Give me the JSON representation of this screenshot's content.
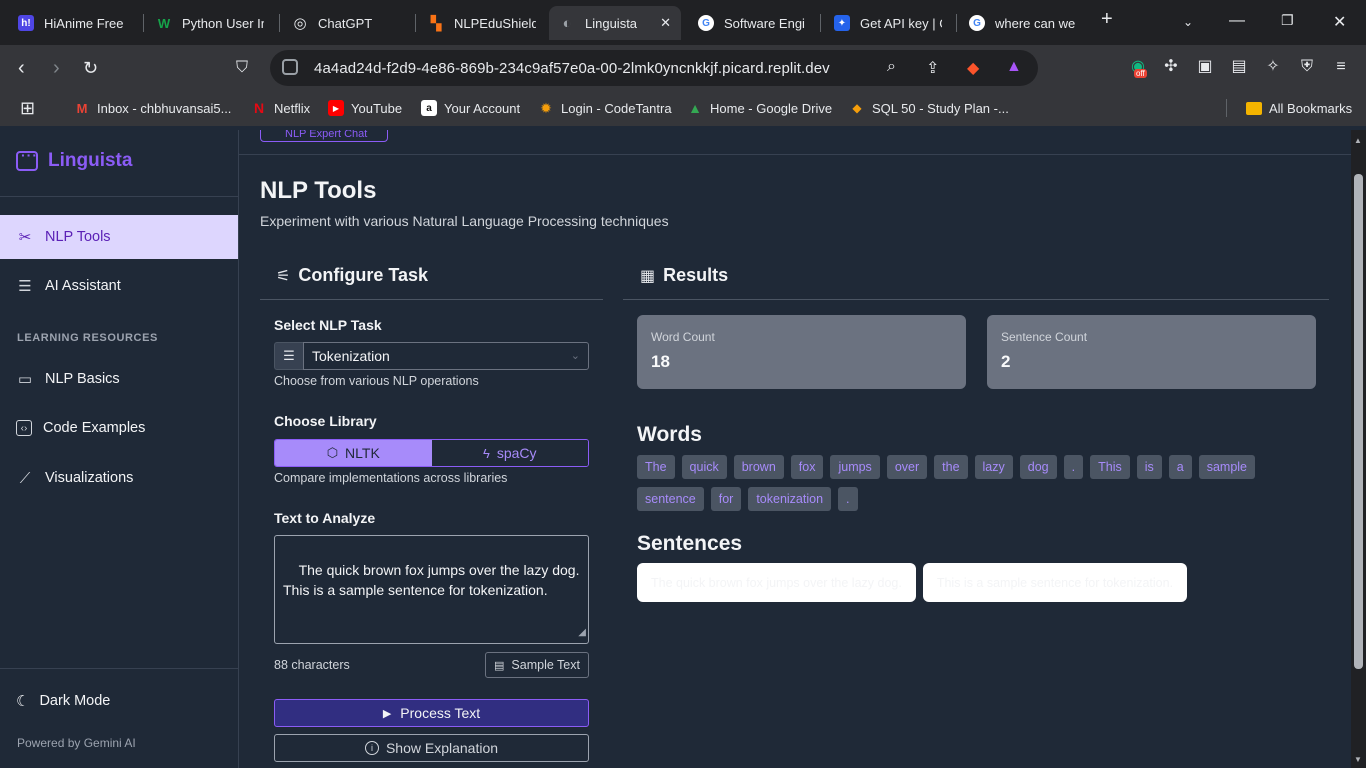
{
  "browser": {
    "tabs": [
      {
        "title": "HiAnime Free",
        "fav_letter": "h!",
        "fav_color": "#4f46e5"
      },
      {
        "title": "Python User In",
        "fav_letter": "W",
        "fav_color": "#16a34a"
      },
      {
        "title": "ChatGPT",
        "fav_letter": "◎",
        "fav_color": "#3c4043"
      },
      {
        "title": "NLPEduShield",
        "fav_letter": "▚",
        "fav_color": "#f97316"
      },
      {
        "title": "Linguista",
        "fav_letter": "◐",
        "fav_color": "#5f6368"
      },
      {
        "title": "Software Engi",
        "fav_letter": "G",
        "fav_color": "#ffffff"
      },
      {
        "title": "Get API key | G",
        "fav_letter": "✦",
        "fav_color": "#2563eb"
      },
      {
        "title": "where can we",
        "fav_letter": "G",
        "fav_color": "#ffffff"
      }
    ],
    "url": "4a4ad24d-f2d9-4e86-869b-234c9af57e0a-00-2lmk0yncnkkjf.picard.replit.dev",
    "ext_badge": "off",
    "bookmarks": [
      {
        "label": "Inbox - chbhuvansai5...",
        "icon": "M",
        "color": "#ea4335"
      },
      {
        "label": "Netflix",
        "icon": "N",
        "color": "#e50914"
      },
      {
        "label": "YouTube",
        "icon": "▶",
        "color": "#ff0000"
      },
      {
        "label": "Your Account",
        "icon": "a",
        "color": "#ffffff"
      },
      {
        "label": "Login - CodeTantra",
        "icon": "✹",
        "color": "#f59e0b"
      },
      {
        "label": "Home - Google Drive",
        "icon": "▲",
        "color": "#34a853"
      },
      {
        "label": "SQL 50 - Study Plan -...",
        "icon": "◆",
        "color": "#f59e0b"
      }
    ],
    "all_bookmarks": "All Bookmarks"
  },
  "sidebar": {
    "brand": "Linguista",
    "nav": [
      {
        "label": "NLP Tools",
        "icon": "scissors-icon",
        "active": true
      },
      {
        "label": "AI Assistant",
        "icon": "chat-icon",
        "active": false
      }
    ],
    "section_label": "LEARNING RESOURCES",
    "resources": [
      {
        "label": "NLP Basics",
        "icon": "book-icon"
      },
      {
        "label": "Code Examples",
        "icon": "code-icon"
      },
      {
        "label": "Visualizations",
        "icon": "chart-icon"
      }
    ],
    "dark_mode": "Dark Mode",
    "powered_by": "Powered by Gemini AI"
  },
  "main": {
    "top_chip": "NLP Expert Chat",
    "title": "NLP Tools",
    "subtitle": "Experiment with various Natural Language Processing techniques",
    "configure": {
      "heading": "Configure Task",
      "task_label": "Select NLP Task",
      "task_value": "Tokenization",
      "task_hint": "Choose from various NLP operations",
      "library_label": "Choose Library",
      "lib_nltk": "NLTK",
      "lib_spacy": "spaCy",
      "library_hint": "Compare implementations across libraries",
      "text_label": "Text to Analyze",
      "text_value": "The quick brown fox jumps over the lazy dog.\nThis is a sample sentence for tokenization.",
      "char_count": "88 characters",
      "sample_button": "Sample Text",
      "process_button": "Process Text",
      "explain_button": "Show Explanation"
    },
    "results": {
      "heading": "Results",
      "word_count_label": "Word Count",
      "word_count": "18",
      "sentence_count_label": "Sentence Count",
      "sentence_count": "2",
      "words_title": "Words",
      "words": [
        "The",
        "quick",
        "brown",
        "fox",
        "jumps",
        "over",
        "the",
        "lazy",
        "dog",
        ".",
        "This",
        "is",
        "a",
        "sample",
        "sentence",
        "for",
        "tokenization",
        "."
      ],
      "sentences_title": "Sentences",
      "sentences": [
        "The quick brown fox jumps over the lazy dog.",
        "This is a sample sentence for tokenization."
      ]
    }
  },
  "colors": {
    "accent": "#8b5cf6",
    "active_nav_bg": "#ddd6fe",
    "chip_bg": "#4b5563",
    "stat_card_bg": "#6b7280"
  }
}
